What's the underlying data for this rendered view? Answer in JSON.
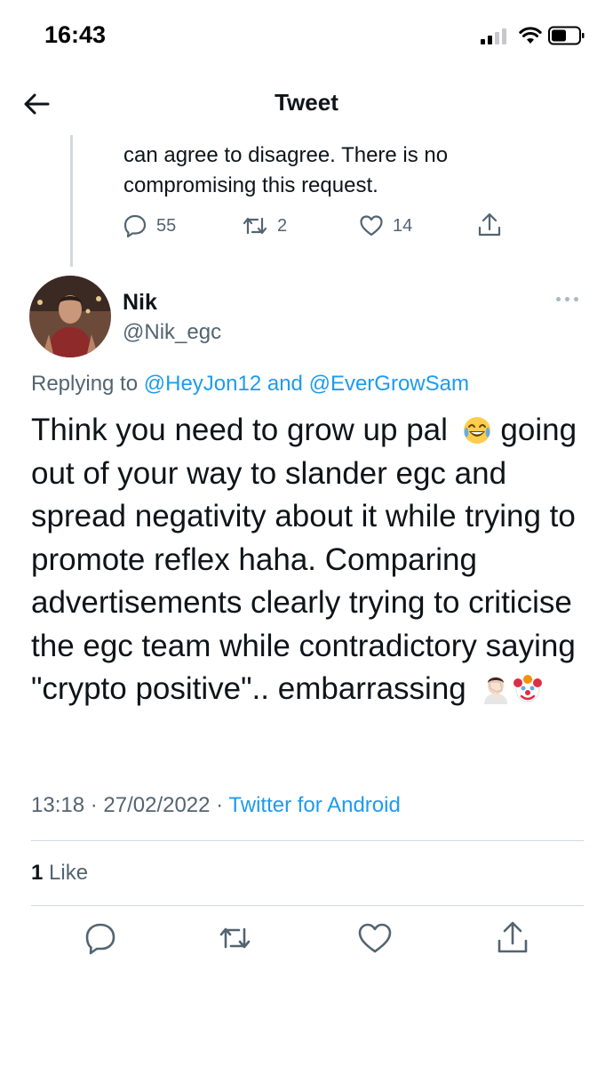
{
  "status_bar": {
    "time": "16:43"
  },
  "nav": {
    "title": "Tweet"
  },
  "previous_tweet": {
    "text": "can agree to disagree. There is no compromising this request.",
    "replies": "55",
    "retweets": "2",
    "likes": "14"
  },
  "tweet": {
    "author_name": "Nik",
    "author_handle": "@Nik_egc",
    "replying_prefix": "Replying to ",
    "reply_to_1": "@HeyJon12",
    "reply_to_and": " and ",
    "reply_to_2": "@EverGrowSam",
    "body": "Think you need to grow up pal",
    "body_emoji_1": "tears-of-joy-emoji",
    "body_cont": "going out of your way to slander egc and spread negativity about it while trying to promote reflex haha. Comparing advertisements clearly trying to criticise the egc team while contradictory saying \"crypto positive\".. embarrassing",
    "body_emoji_2": "facepalm-emoji",
    "body_emoji_3": "clown-emoji",
    "time": "13:18 · 27/02/2022 · ",
    "source": "Twitter for Android",
    "like_count": "1",
    "like_label": " Like"
  },
  "action_bar": {
    "icons": [
      "reply-icon",
      "retweet-icon",
      "like-icon",
      "share-icon"
    ]
  },
  "colors": {
    "accent": "#1d9bf0",
    "secondary_text": "#536471",
    "primary_text": "#0f1419",
    "divider": "#cfd9de"
  }
}
